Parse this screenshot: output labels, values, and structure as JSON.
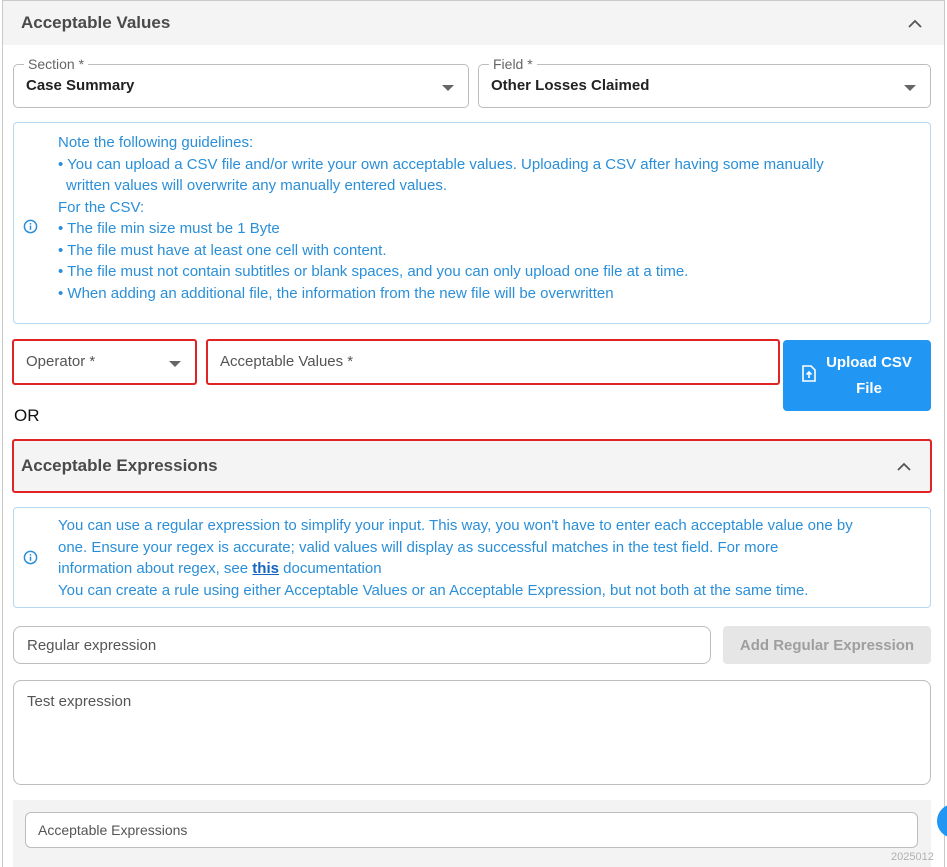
{
  "acceptable_values": {
    "title": "Acceptable Values",
    "section": {
      "label": "Section *",
      "value": "Case Summary"
    },
    "field": {
      "label": "Field *",
      "value": "Other Losses Claimed"
    },
    "note": {
      "heading": "Note the following guidelines:",
      "bullet1_line1": "• You can upload a CSV file and/or write your own acceptable values. Uploading a CSV after having some manually",
      "bullet1_line2": "written values will overwrite any manually entered values.",
      "csv_heading": "For the CSV:",
      "csv_items": [
        "• The file min size must be 1 Byte",
        "• The file must have at least one cell with content.",
        "• The file must not contain subtitles or blank spaces, and you can only upload one file at a time.",
        "• When adding an additional file, the information from the new file will be overwritten"
      ]
    },
    "operator_label": "Operator *",
    "values_placeholder": "Acceptable Values *",
    "upload_line1": "Upload CSV",
    "upload_line2": "File"
  },
  "or_text": "OR",
  "acceptable_expressions": {
    "title": "Acceptable Expressions",
    "info": {
      "line1": "You can use a regular expression to simplify your input. This way, you won't have to enter each acceptable value one by",
      "line2": "one. Ensure your regex is accurate; valid values will display as successful matches in the test field. For more",
      "line3_before": "information about regex, see",
      "link": "this",
      "line3_after": "documentation",
      "line4": "You can create a rule using either Acceptable Values or an Acceptable Expression, but not both at the same time."
    },
    "regex_placeholder": "Regular expression",
    "add_button": "Add Regular Expression",
    "test_placeholder": "Test expression",
    "list_placeholder": "Acceptable Expressions"
  },
  "footer_partial": "2025012",
  "colors": {
    "accent": "#2196f3",
    "info_text": "#2a8fd8",
    "highlight": "#e02424"
  },
  "icons": [
    "chevron-up-icon",
    "caret-down-icon",
    "info-icon",
    "upload-file-icon"
  ]
}
